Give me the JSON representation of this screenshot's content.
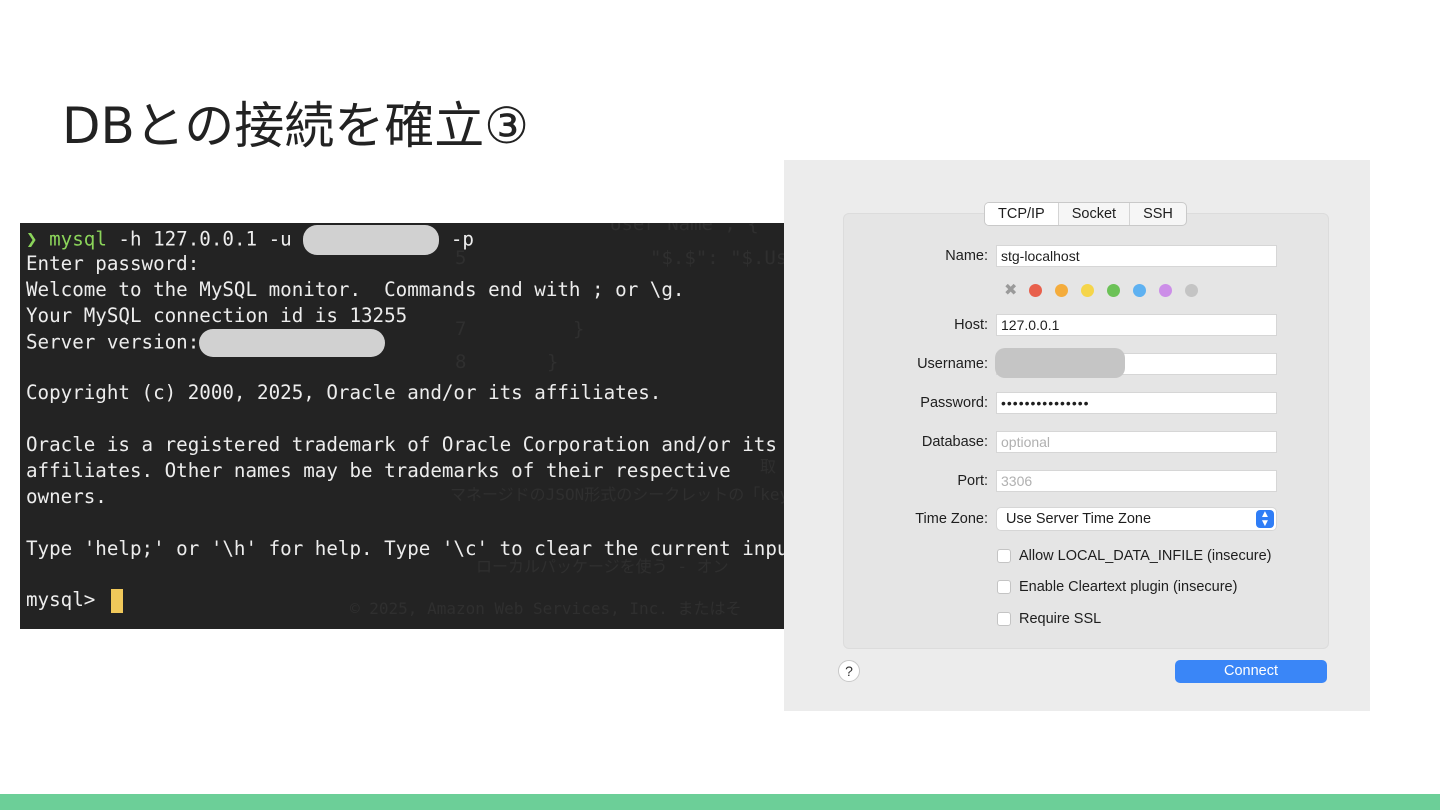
{
  "slide": {
    "title": "DBとの接続を確立③"
  },
  "terminal": {
    "cmd_prefix": "❯ ",
    "cmd_name": "mysql",
    "cmd_args1": " -h 127.0.0.1 -u ",
    "cmd_args2": " -p",
    "lines": [
      "Enter password:",
      "Welcome to the MySQL monitor.  Commands end with ; or \\g.",
      "Your MySQL connection id is 13255"
    ],
    "server_version_label": "Server version:",
    "copyright": "Copyright (c) 2000, 2025, Oracle and/or its affiliates.",
    "notice_lines": [
      "Oracle is a registered trademark of Oracle Corporation and/or its",
      "affiliates. Other names may be trademarks of their respective",
      "owners."
    ],
    "help_line": "Type 'help;' or '\\h' for help. Type '\\c' to clear the current inpu",
    "mysql_prompt": "mysql> ",
    "bg_ghost": {
      "line1": "User Name\", {",
      "line2": "\"$.$\": \"$.Use",
      "num5": "5",
      "num7": "7",
      "num8": "8",
      "brace7": "}",
      "brace8": "}",
      "ghost_right1": "取",
      "ghost_right2": "key",
      "ghost_mid1": "マネージドのJSON形式のシークレットの「key」",
      "ghost_mid2": "ローカルパッケージを使う - オン",
      "ghost_copyright": "© 2025, Amazon Web Services, Inc. またはそ"
    }
  },
  "dialog": {
    "tabs": [
      "TCP/IP",
      "Socket",
      "SSH"
    ],
    "active_tab": "TCP/IP",
    "name_label": "Name:",
    "name_value": "stg-localhost",
    "colors": [
      "#e8604c",
      "#f4ac3c",
      "#f5d54a",
      "#6cc257",
      "#5eb1f1",
      "#cc8ee8",
      "#c4c4c4"
    ],
    "host_label": "Host:",
    "host_value": "127.0.0.1",
    "username_label": "Username:",
    "password_label": "Password:",
    "password_value": "•••••••••••••••",
    "database_label": "Database:",
    "database_placeholder": "optional",
    "port_label": "Port:",
    "port_placeholder": "3306",
    "timezone_label": "Time Zone:",
    "timezone_value": "Use Server Time Zone",
    "checkboxes": [
      "Allow LOCAL_DATA_INFILE (insecure)",
      "Enable Cleartext plugin (insecure)",
      "Require SSL"
    ],
    "help_label": "?",
    "connect_label": "Connect"
  }
}
